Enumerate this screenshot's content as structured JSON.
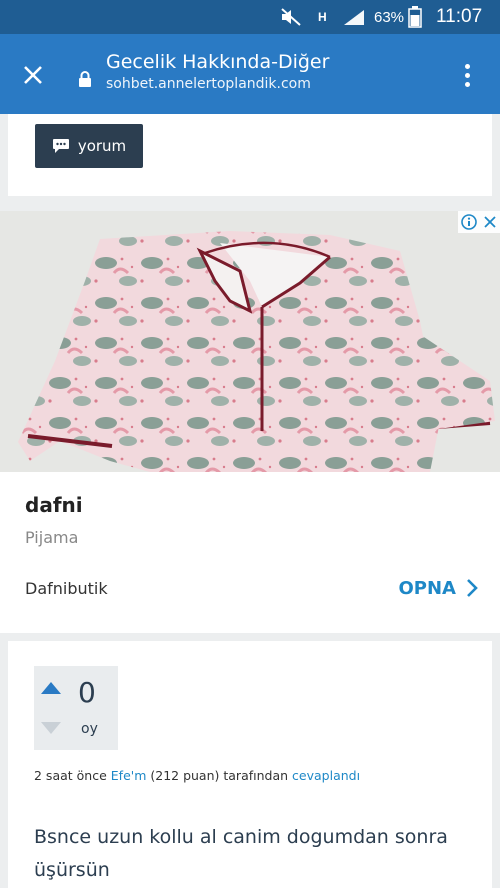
{
  "status_bar": {
    "network_label": "H",
    "battery": "63%",
    "time": "11:07",
    "icons": [
      "mute-icon",
      "signal-icon",
      "battery-icon"
    ]
  },
  "app_bar": {
    "title": "Gecelik Hakkında-Diğer",
    "url": "sohbet.annelertoplandik.com",
    "icons": [
      "close-icon",
      "lock-icon",
      "more-vert-icon"
    ],
    "color": "#2a7ac4"
  },
  "comment_button": {
    "label": "yorum",
    "icon": "speech-bubble-icon"
  },
  "ad": {
    "title": "dafni",
    "subtitle": "Pijama",
    "advertiser": "Dafnibutik",
    "cta": "OPNA",
    "cta_color": "#1e88c7",
    "image_desc_icon": "pajama-product-image"
  },
  "answer": {
    "votes": "0",
    "votes_label": "oy",
    "meta": {
      "time": "2 saat önce",
      "author": "Efe'm",
      "points": "(212 puan)",
      "by": "tarafından",
      "action": "cevaplandı"
    },
    "text": "Bsnce uzun kollu al canim dogumdan sonra üşürsün"
  },
  "colors": {
    "status_bar": "#1f5d93",
    "button_dark": "#2c3e50",
    "page_bg": "#eceeef",
    "vote_box": "#e9ecee"
  }
}
